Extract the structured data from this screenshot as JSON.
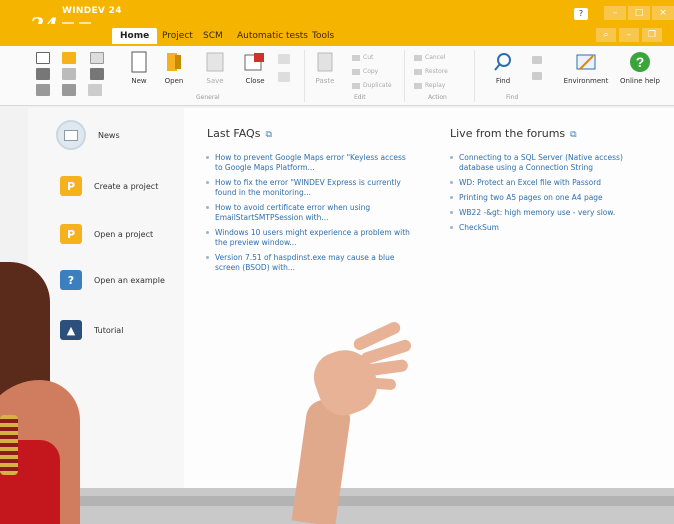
{
  "app": {
    "logo": "24",
    "name": "WINDEV 24"
  },
  "tabs": [
    {
      "label": "Home",
      "active": true
    },
    {
      "label": "Project"
    },
    {
      "label": "SCM"
    },
    {
      "label": "Automatic tests"
    },
    {
      "label": "Tools"
    }
  ],
  "ribbon": {
    "new": "New",
    "open": "Open",
    "save": "Save",
    "close": "Close",
    "paste": "Paste",
    "cut": "Cut",
    "copy": "Copy",
    "duplicate": "Duplicate",
    "cancel": "Cancel",
    "restore": "Restore",
    "replay": "Replay",
    "find": "Find",
    "environment": "Environment",
    "online_help": "Online help",
    "groups": {
      "general": "General",
      "edit": "Edit",
      "action": "Action",
      "find": "Find"
    }
  },
  "nav": {
    "news": "News",
    "create_project": "Create a project",
    "open_project": "Open a project",
    "open_example": "Open an example",
    "tutorial": "Tutorial"
  },
  "faqs": {
    "title": "Last FAQs",
    "items": [
      "How to prevent Google Maps error \"Keyless access to Google Maps Platform...",
      "How to fix the error \"WINDEV Express is currently found in the monitoring...",
      "How to avoid certificate error when using EmailStartSMTPSession with...",
      "Windows 10 users might experience a problem with the preview window...",
      "Version 7.51 of haspdinst.exe may cause a blue screen (BSOD) with..."
    ]
  },
  "forums": {
    "title": "Live from the forums",
    "items": [
      "Connecting to a SQL Server (Native access) database using a Connection String",
      "WD: Protect an Excel file with Passord",
      "Printing two A5 pages on one A4 page",
      "WB22 -&gt: high memory use - very slow.",
      "CheckSum"
    ]
  },
  "colors": {
    "title_bar": "#f4b400",
    "link": "#2f6fad",
    "create_project_icon": "#f5b21c",
    "open_project_icon": "#f5b21c",
    "open_example_icon": "#3c7fbe",
    "tutorial_icon": "#2d4f7c",
    "online_help_icon": "#3aa53a"
  }
}
